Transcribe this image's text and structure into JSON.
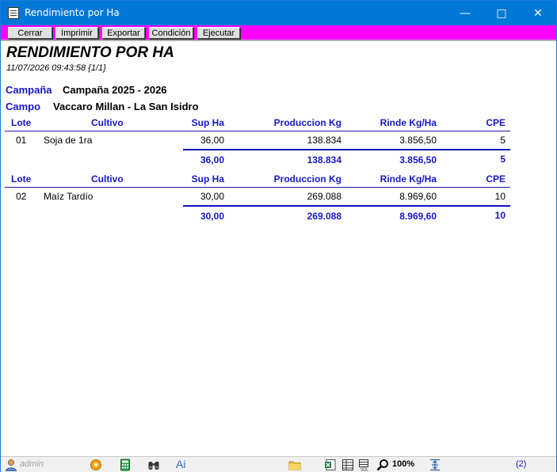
{
  "window": {
    "title": "Rendimiento por Ha"
  },
  "toolbar": {
    "cerrar": "Cerrar",
    "imprimir": "Imprimir",
    "exportar": "Exportar",
    "condicion": "Condición",
    "ejecutar": "Ejecutar"
  },
  "report": {
    "title": "RENDIMIENTO POR HA",
    "datetime": "11/07/2026 09:43:58 {1/1}",
    "campana_label": "Campaña",
    "campana_value": "Campaña 2025 - 2026",
    "campo_label": "Campo",
    "campo_value": "Vaccaro Millan - La San Isidro",
    "columns": {
      "lote": "Lote",
      "cultivo": "Cultivo",
      "sup_ha": "Sup Ha",
      "produccion": "Produccion Kg",
      "rinde": "Rinde Kg/Ha",
      "cpe": "CPE"
    },
    "groups": [
      {
        "row": {
          "lote": "01",
          "cultivo": "Soja de 1ra",
          "sup_ha": "36,00",
          "produccion": "138.834",
          "rinde": "3.856,50",
          "cpe": "5"
        },
        "total": {
          "sup_ha": "36,00",
          "produccion": "138.834",
          "rinde": "3.856,50",
          "cpe": "5"
        }
      },
      {
        "row": {
          "lote": "02",
          "cultivo": "Maíz Tardío",
          "sup_ha": "30,00",
          "produccion": "269.088",
          "rinde": "8.969,60",
          "cpe": "10"
        },
        "total": {
          "sup_ha": "30,00",
          "produccion": "269.088",
          "rinde": "8.969,60",
          "cpe": "10"
        }
      }
    ]
  },
  "statusbar": {
    "user": "admin",
    "ai_label": "Ai",
    "zoom": "100%",
    "count": "(2)"
  },
  "colors": {
    "titlebar": "#0078d7",
    "toolbar": "#ff00ff",
    "accent_blue": "#1717c8"
  }
}
